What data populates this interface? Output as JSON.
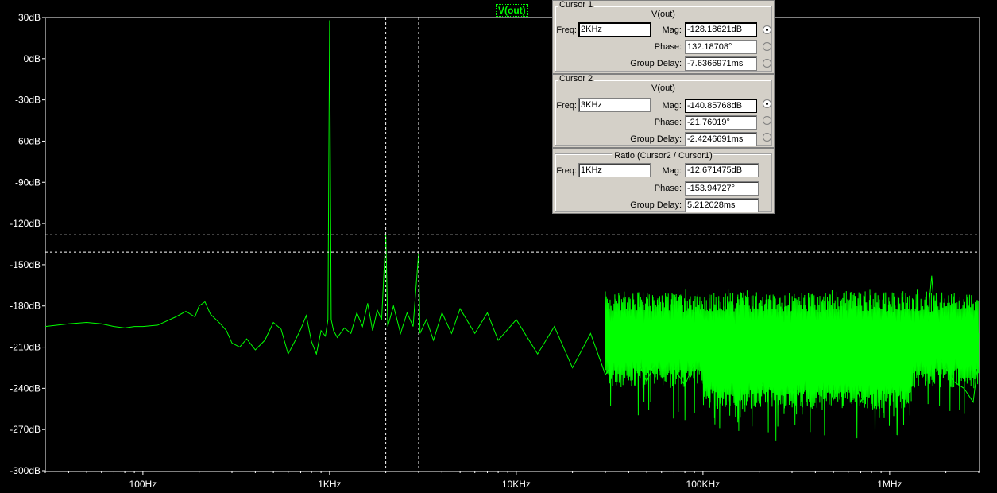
{
  "chart_data": {
    "type": "line",
    "trace_name": "V(out)",
    "xscale": "log",
    "xlim": [
      30,
      3000000
    ],
    "ylim": [
      -300,
      30
    ],
    "y_ticks": [
      "30dB",
      "0dB",
      "-30dB",
      "-60dB",
      "-90dB",
      "-120dB",
      "-150dB",
      "-180dB",
      "-210dB",
      "-240dB",
      "-270dB",
      "-300dB"
    ],
    "y_tick_values": [
      30,
      0,
      -30,
      -60,
      -90,
      -120,
      -150,
      -180,
      -210,
      -240,
      -270,
      -300
    ],
    "x_ticks": [
      "100Hz",
      "1KHz",
      "10KHz",
      "100KHz",
      "1MHz"
    ],
    "x_tick_values": [
      100,
      1000,
      10000,
      100000,
      1000000
    ],
    "series_color": "#00ff00",
    "cursor_color": "#ffffff",
    "series_points": [
      [
        30,
        -195
      ],
      [
        40,
        -193
      ],
      [
        50,
        -192
      ],
      [
        60,
        -193
      ],
      [
        70,
        -195
      ],
      [
        80,
        -196
      ],
      [
        90,
        -195
      ],
      [
        100,
        -195
      ],
      [
        120,
        -194
      ],
      [
        150,
        -188
      ],
      [
        170,
        -184
      ],
      [
        190,
        -188
      ],
      [
        200,
        -180
      ],
      [
        215,
        -177
      ],
      [
        230,
        -186
      ],
      [
        260,
        -193
      ],
      [
        280,
        -198
      ],
      [
        300,
        -207
      ],
      [
        330,
        -210
      ],
      [
        360,
        -204
      ],
      [
        400,
        -212
      ],
      [
        450,
        -205
      ],
      [
        500,
        -192
      ],
      [
        550,
        -197
      ],
      [
        600,
        -215
      ],
      [
        650,
        -206
      ],
      [
        700,
        -197
      ],
      [
        750,
        -187
      ],
      [
        800,
        -206
      ],
      [
        850,
        -215
      ],
      [
        900,
        -198
      ],
      [
        950,
        -202
      ],
      [
        980,
        -190
      ],
      [
        1000,
        28
      ],
      [
        1020,
        -190
      ],
      [
        1050,
        -198
      ],
      [
        1100,
        -203
      ],
      [
        1200,
        -196
      ],
      [
        1300,
        -200
      ],
      [
        1400,
        -185
      ],
      [
        1500,
        -195
      ],
      [
        1600,
        -178
      ],
      [
        1700,
        -198
      ],
      [
        1800,
        -183
      ],
      [
        1900,
        -190
      ],
      [
        2000,
        -128
      ],
      [
        2050,
        -195
      ],
      [
        2200,
        -180
      ],
      [
        2400,
        -200
      ],
      [
        2600,
        -185
      ],
      [
        2800,
        -195
      ],
      [
        3000,
        -141
      ],
      [
        3050,
        -200
      ],
      [
        3300,
        -190
      ],
      [
        3600,
        -205
      ],
      [
        4000,
        -185
      ],
      [
        4500,
        -200
      ],
      [
        5000,
        -182
      ],
      [
        6000,
        -200
      ],
      [
        7000,
        -185
      ],
      [
        8000,
        -205
      ],
      [
        10000,
        -190
      ],
      [
        13000,
        -215
      ],
      [
        16000,
        -195
      ],
      [
        20000,
        -225
      ],
      [
        25000,
        -200
      ],
      [
        30000,
        -230
      ],
      [
        40000,
        -205
      ],
      [
        50000,
        -235
      ],
      [
        60000,
        -210
      ],
      [
        80000,
        -238
      ],
      [
        100000,
        -205
      ],
      [
        130000,
        -240
      ],
      [
        170000,
        -210
      ],
      [
        200000,
        -242
      ],
      [
        250000,
        -215
      ],
      [
        300000,
        -245
      ],
      [
        400000,
        -210
      ],
      [
        500000,
        -248
      ],
      [
        600000,
        -212
      ],
      [
        700000,
        -250
      ],
      [
        900000,
        -215
      ],
      [
        1000000,
        -245
      ],
      [
        1200000,
        -205
      ],
      [
        1400000,
        -200
      ],
      [
        1600000,
        -190
      ],
      [
        1680000,
        -158
      ],
      [
        1750000,
        -190
      ],
      [
        1900000,
        -220
      ],
      [
        2200000,
        -235
      ],
      [
        2500000,
        -240
      ],
      [
        2800000,
        -250
      ],
      [
        2950000,
        -225
      ],
      [
        3000000,
        -200
      ]
    ],
    "noise_bands": [
      {
        "x": [
          30000,
          3000000
        ],
        "y_top": -170,
        "y_bottom": -240
      },
      {
        "x": [
          100000,
          1300000
        ],
        "y_top": -190,
        "y_bottom": -255
      }
    ],
    "cursors": [
      {
        "freq_hz": 2000,
        "mag_db": -128.18621
      },
      {
        "freq_hz": 3000,
        "mag_db": -140.85768
      }
    ]
  },
  "cursor1": {
    "title": "Cursor 1",
    "trace": "V(out)",
    "freq_label": "Freq:",
    "freq_value": "2KHz",
    "mag_label": "Mag:",
    "mag_value": "-128.18621dB",
    "phase_label": "Phase:",
    "phase_value": "132.18708°",
    "gd_label": "Group Delay:",
    "gd_value": "-7.6366971ms"
  },
  "cursor2": {
    "title": "Cursor 2",
    "trace": "V(out)",
    "freq_label": "Freq:",
    "freq_value": "3KHz",
    "mag_label": "Mag:",
    "mag_value": "-140.85768dB",
    "phase_label": "Phase:",
    "phase_value": "-21.76019°",
    "gd_label": "Group Delay:",
    "gd_value": "-2.4246691ms"
  },
  "ratio": {
    "title": "Ratio (Cursor2 / Cursor1)",
    "freq_label": "Freq:",
    "freq_value": "1KHz",
    "mag_label": "Mag:",
    "mag_value": "-12.671475dB",
    "phase_label": "Phase:",
    "phase_value": "-153.94727°",
    "gd_label": "Group Delay:",
    "gd_value": "5.212028ms"
  }
}
